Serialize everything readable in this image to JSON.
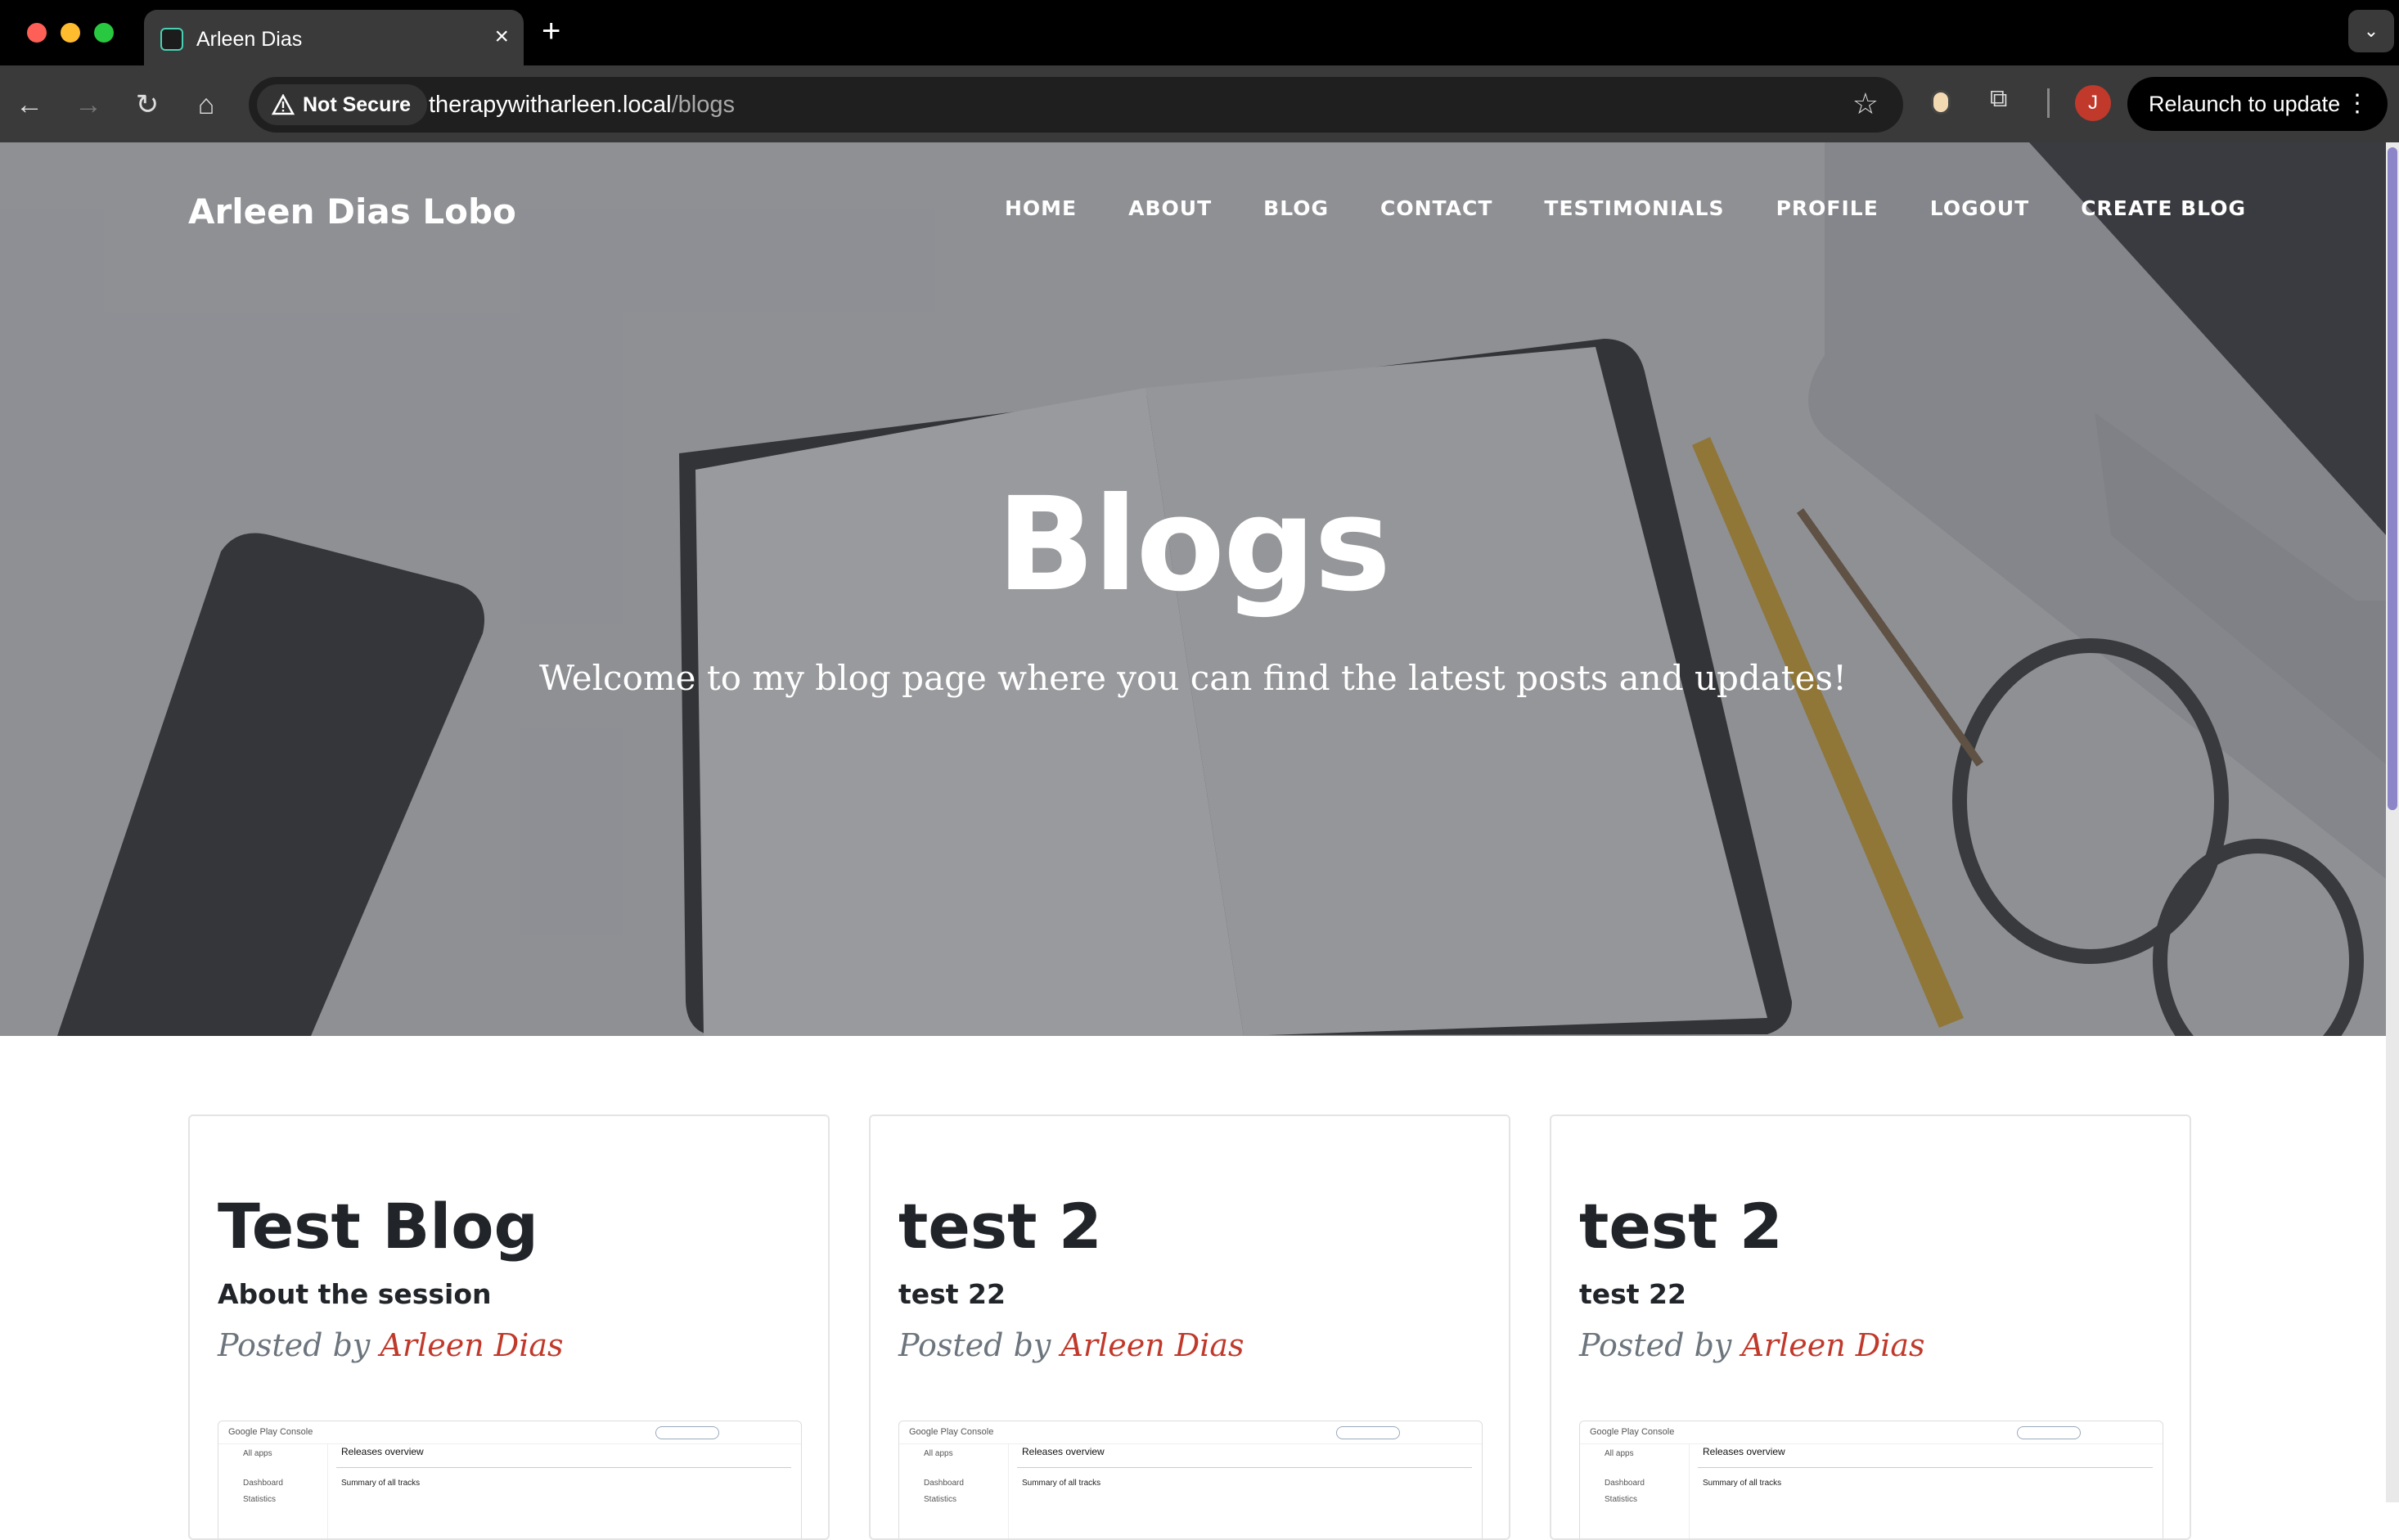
{
  "browser": {
    "tab_title": "Arleen Dias",
    "security_label": "Not Secure",
    "url_host": "therapywitharleen.local",
    "url_path": "/blogs",
    "profile_initial": "J",
    "relaunch_label": "Relaunch to update"
  },
  "site": {
    "brand": "Arleen Dias Lobo",
    "nav": [
      "HOME",
      "ABOUT",
      "BLOG",
      "CONTACT",
      "TESTIMONIALS",
      "PROFILE",
      "LOGOUT",
      "CREATE BLOG"
    ]
  },
  "hero": {
    "title": "Blogs",
    "subtitle": "Welcome to my blog page where you can find the latest posts and updates!"
  },
  "posts": [
    {
      "title": "Test Blog",
      "subtitle": "About the session",
      "posted_by_prefix": "Posted by",
      "author": "Arleen Dias"
    },
    {
      "title": "test 2",
      "subtitle": "test 22",
      "posted_by_prefix": "Posted by",
      "author": "Arleen Dias"
    },
    {
      "title": "test 2",
      "subtitle": "test 22",
      "posted_by_prefix": "Posted by",
      "author": "Arleen Dias"
    }
  ],
  "thumbnail": {
    "app_name": "Google Play Console",
    "heading": "Releases overview",
    "side_item_1": "All apps",
    "side_item_2": "Dashboard",
    "side_item_3": "Statistics",
    "summary": "Summary of all tracks"
  },
  "colors": {
    "accent_author": "#c0392b",
    "scroll_thumb": "#8c86c8"
  }
}
